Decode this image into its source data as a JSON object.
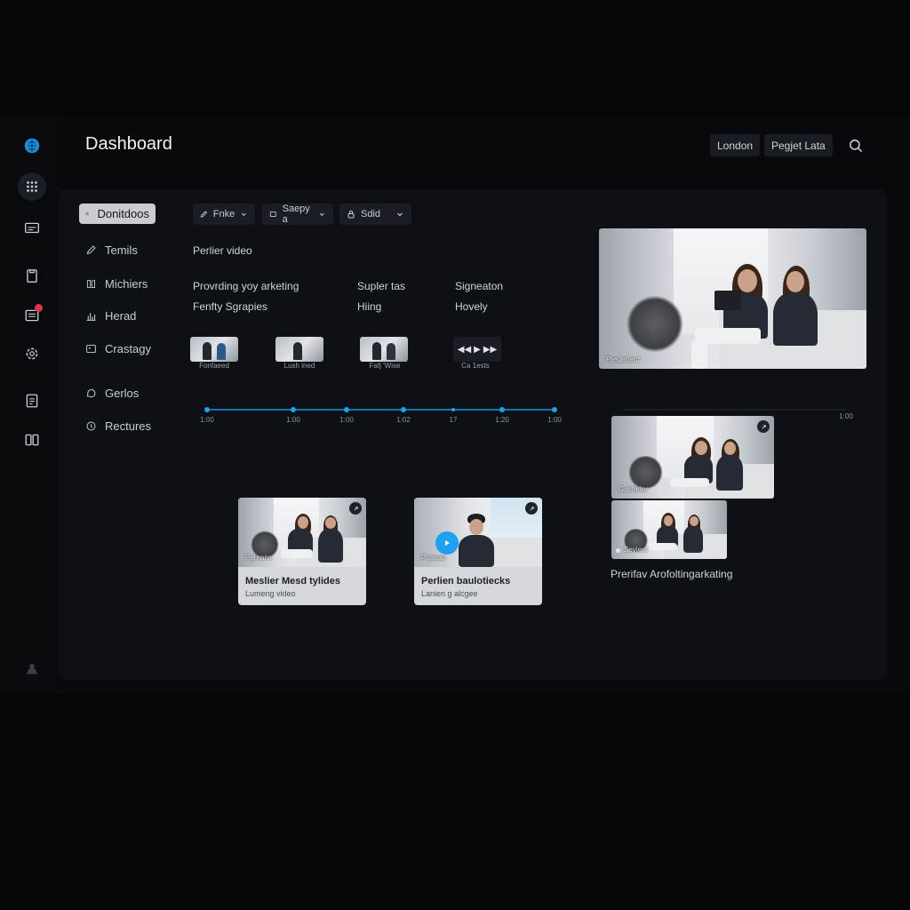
{
  "header": {
    "title": "Dashboard",
    "buttons": [
      "London",
      "Pegjet Lata"
    ]
  },
  "rail": {
    "icons": [
      "brain-logo-icon",
      "grid-icon",
      "monitor-icon",
      "clipboard-icon",
      "notes-icon",
      "gear-icon",
      "document-icon",
      "split-icon",
      "profile-icon"
    ]
  },
  "nav": {
    "items": [
      {
        "label": "Donitdoos",
        "icon": "search-icon"
      },
      {
        "label": "Temils",
        "icon": "pen-icon"
      },
      {
        "label": "Michiers",
        "icon": "book-icon"
      },
      {
        "label": "Herad",
        "icon": "chart-icon"
      },
      {
        "label": "Crastagy",
        "icon": "image-icon"
      },
      {
        "label": "Gerlos",
        "icon": "chat-icon"
      },
      {
        "label": "Rectures",
        "icon": "clock-icon"
      }
    ]
  },
  "filters": [
    {
      "label": "Fnke"
    },
    {
      "label": "Saepy a"
    },
    {
      "label": "Sdid"
    }
  ],
  "section_title": "Perlier video",
  "rows": {
    "col1": [
      "Provrding yoy arketing",
      "Fenfty Sgrapies"
    ],
    "col2": [
      "Supler tas",
      "Hiing"
    ],
    "col3": [
      "Signeaton",
      "Hovely"
    ]
  },
  "thumbs": {
    "captions": [
      "Fonfaeed",
      "Lush ined",
      "Fafj 'Wise",
      "Ca 1ests"
    ]
  },
  "timeline": {
    "labels": [
      "1:00",
      "1:00",
      "1:00",
      "1:02",
      "17",
      "1:20",
      "1:00"
    ],
    "right_label": "1:00"
  },
  "preview": {
    "caption": "Prederferd"
  },
  "small_previews": {
    "top_caption": "Gusteder",
    "bottom_caption": "Seviers"
  },
  "cards": [
    {
      "title": "Meslier Mesd tylides",
      "subtitle": "Lumeng video",
      "caption": "Pernans"
    },
    {
      "title": "Perlien baulotiecks",
      "subtitle": "Lanien g alcgee",
      "caption": "Poasad"
    }
  ],
  "right_caption": "Prerifav Arofoltingarkating",
  "colors": {
    "accent": "#1ea1f0",
    "badge": "#e0334f",
    "panel": "#0d1015"
  }
}
